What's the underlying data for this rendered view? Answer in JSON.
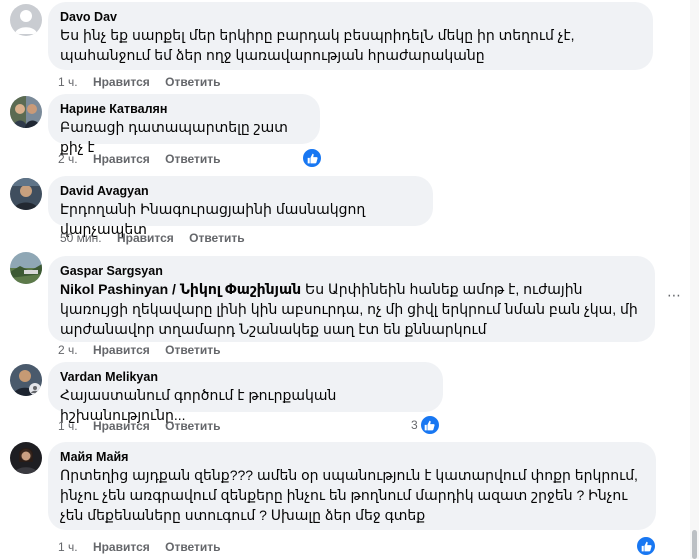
{
  "comments": [
    {
      "author": "Davo Dav",
      "text": "Ես ինչ եք սարքել մեր երկիրը բարդակ բեսպրիդելՆ մեկը իր տեղում չէ, պահանջում եմ ձեր ողջ կառավարության հրաժարականը",
      "time": "1 ч.",
      "like": "Нравится",
      "reply": "Ответить"
    },
    {
      "author": "Нарине Катвалян",
      "text": "Բառացի դատապարտելը շատ քիչ է",
      "time": "2 ч.",
      "like": "Нравится",
      "reply": "Ответить"
    },
    {
      "author": "David Avagyan",
      "text": "Էրդողանի Ինագուրացյաինի մասնակցող վարչապետ",
      "time": "50 мин.",
      "like": "Нравится",
      "reply": "Ответить"
    },
    {
      "author": "Gaspar Sargsyan",
      "tag": "Nikol Pashinyan / Նիկոլ Փաշինյան",
      "text": " Ես Արփինեին հանեք ամոթ է, ուժային կառույցի ղեկավարը լինի կին աբսուրդա, ոչ մի ցիվլ երկրում նման բան չկա, մի արժանավոր տղամարդ Նշանակեք սաղ էտ են քննարկում",
      "time": "2 ч.",
      "like": "Нравится",
      "reply": "Ответить"
    },
    {
      "author": "Vardan Melikyan",
      "text": "Հայաստանում գործում է թուրքական իշխանությունը...",
      "time": "1 ч.",
      "like": "Нравится",
      "reply": "Ответить",
      "reaction_count": "3"
    },
    {
      "author": "Майя Майя",
      "text": "Որտեղից այդքան զենք??? ամեն օր սպանություն է կատարվում փոքր երկրում, ինչու չեն առգրավում զենքերը ինչու են թողնում մարդիկ ազատ շրջեն ? Ինչու չեն մեքենաները ստուգում ? Սխալը ձեր մեջ գտեք",
      "time": "1 ч.",
      "like": "Нравится",
      "reply": "Ответить"
    }
  ],
  "colors": {
    "bubble": "#f0f2f5",
    "meta": "#65676b",
    "like_blue": "#1877f2"
  },
  "icons": {
    "like": "thumbs-up-icon",
    "more": "more-options-icon"
  }
}
